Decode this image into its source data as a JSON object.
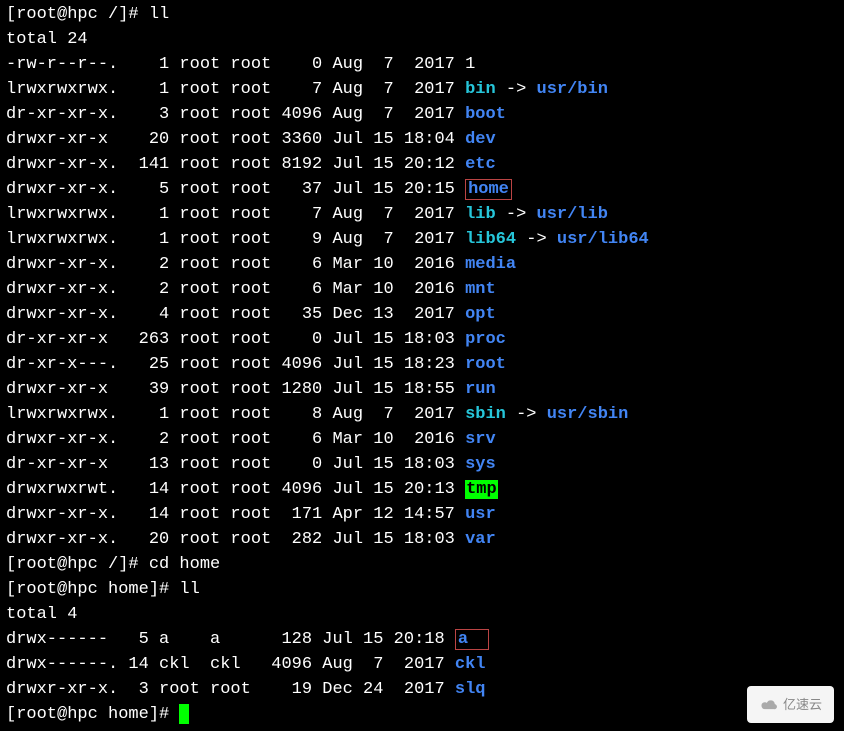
{
  "prompt1": "[root@hpc /]# ll",
  "total1": "total 24",
  "listing1": [
    {
      "perm": "-rw-r--r--.",
      "links": "1",
      "owner": "root",
      "group": "root",
      "size": "0",
      "date": "Aug  7  2017",
      "name": "1",
      "type": "file"
    },
    {
      "perm": "lrwxrwxrwx.",
      "links": "1",
      "owner": "root",
      "group": "root",
      "size": "7",
      "date": "Aug  7  2017",
      "name": "bin",
      "type": "link",
      "target": "usr/bin"
    },
    {
      "perm": "dr-xr-xr-x.",
      "links": "3",
      "owner": "root",
      "group": "root",
      "size": "4096",
      "date": "Aug  7  2017",
      "name": "boot",
      "type": "dir"
    },
    {
      "perm": "drwxr-xr-x",
      "links": "20",
      "owner": "root",
      "group": "root",
      "size": "3360",
      "date": "Jul 15 18:04",
      "name": "dev",
      "type": "dir"
    },
    {
      "perm": "drwxr-xr-x.",
      "links": "141",
      "owner": "root",
      "group": "root",
      "size": "8192",
      "date": "Jul 15 20:12",
      "name": "etc",
      "type": "dir"
    },
    {
      "perm": "drwxr-xr-x.",
      "links": "5",
      "owner": "root",
      "group": "root",
      "size": "37",
      "date": "Jul 15 20:15",
      "name": "home",
      "type": "dir",
      "highlight": "home"
    },
    {
      "perm": "lrwxrwxrwx.",
      "links": "1",
      "owner": "root",
      "group": "root",
      "size": "7",
      "date": "Aug  7  2017",
      "name": "lib",
      "type": "link",
      "target": "usr/lib"
    },
    {
      "perm": "lrwxrwxrwx.",
      "links": "1",
      "owner": "root",
      "group": "root",
      "size": "9",
      "date": "Aug  7  2017",
      "name": "lib64",
      "type": "link",
      "target": "usr/lib64"
    },
    {
      "perm": "drwxr-xr-x.",
      "links": "2",
      "owner": "root",
      "group": "root",
      "size": "6",
      "date": "Mar 10  2016",
      "name": "media",
      "type": "dir"
    },
    {
      "perm": "drwxr-xr-x.",
      "links": "2",
      "owner": "root",
      "group": "root",
      "size": "6",
      "date": "Mar 10  2016",
      "name": "mnt",
      "type": "dir"
    },
    {
      "perm": "drwxr-xr-x.",
      "links": "4",
      "owner": "root",
      "group": "root",
      "size": "35",
      "date": "Dec 13  2017",
      "name": "opt",
      "type": "dir"
    },
    {
      "perm": "dr-xr-xr-x",
      "links": "263",
      "owner": "root",
      "group": "root",
      "size": "0",
      "date": "Jul 15 18:03",
      "name": "proc",
      "type": "dir"
    },
    {
      "perm": "dr-xr-x---.",
      "links": "25",
      "owner": "root",
      "group": "root",
      "size": "4096",
      "date": "Jul 15 18:23",
      "name": "root",
      "type": "dir"
    },
    {
      "perm": "drwxr-xr-x",
      "links": "39",
      "owner": "root",
      "group": "root",
      "size": "1280",
      "date": "Jul 15 18:55",
      "name": "run",
      "type": "dir"
    },
    {
      "perm": "lrwxrwxrwx.",
      "links": "1",
      "owner": "root",
      "group": "root",
      "size": "8",
      "date": "Aug  7  2017",
      "name": "sbin",
      "type": "link",
      "target": "usr/sbin"
    },
    {
      "perm": "drwxr-xr-x.",
      "links": "2",
      "owner": "root",
      "group": "root",
      "size": "6",
      "date": "Mar 10  2016",
      "name": "srv",
      "type": "dir"
    },
    {
      "perm": "dr-xr-xr-x",
      "links": "13",
      "owner": "root",
      "group": "root",
      "size": "0",
      "date": "Jul 15 18:03",
      "name": "sys",
      "type": "dir"
    },
    {
      "perm": "drwxrwxrwt.",
      "links": "14",
      "owner": "root",
      "group": "root",
      "size": "4096",
      "date": "Jul 15 20:13",
      "name": "tmp",
      "type": "sticky"
    },
    {
      "perm": "drwxr-xr-x.",
      "links": "14",
      "owner": "root",
      "group": "root",
      "size": "171",
      "date": "Apr 12 14:57",
      "name": "usr",
      "type": "dir"
    },
    {
      "perm": "drwxr-xr-x.",
      "links": "20",
      "owner": "root",
      "group": "root",
      "size": "282",
      "date": "Jul 15 18:03",
      "name": "var",
      "type": "dir"
    }
  ],
  "prompt2": "[root@hpc /]# cd home",
  "prompt3": "[root@hpc home]# ll",
  "total2": "total 4",
  "listing2": [
    {
      "perm": "drwx------",
      "links": "5",
      "owner": "a",
      "group": "a",
      "size": "128",
      "date": "Jul 15 20:18",
      "name": "a",
      "type": "dir",
      "highlight": "a"
    },
    {
      "perm": "drwx------.",
      "links": "14",
      "owner": "ckl",
      "group": "ckl",
      "size": "4096",
      "date": "Aug  7  2017",
      "name": "ckl",
      "type": "dir"
    },
    {
      "perm": "drwxr-xr-x.",
      "links": "3",
      "owner": "root",
      "group": "root",
      "size": "19",
      "date": "Dec 24  2017",
      "name": "slq",
      "type": "dir"
    }
  ],
  "prompt4": "[root@hpc home]# ",
  "arrow": " -> ",
  "watermark": "亿速云"
}
